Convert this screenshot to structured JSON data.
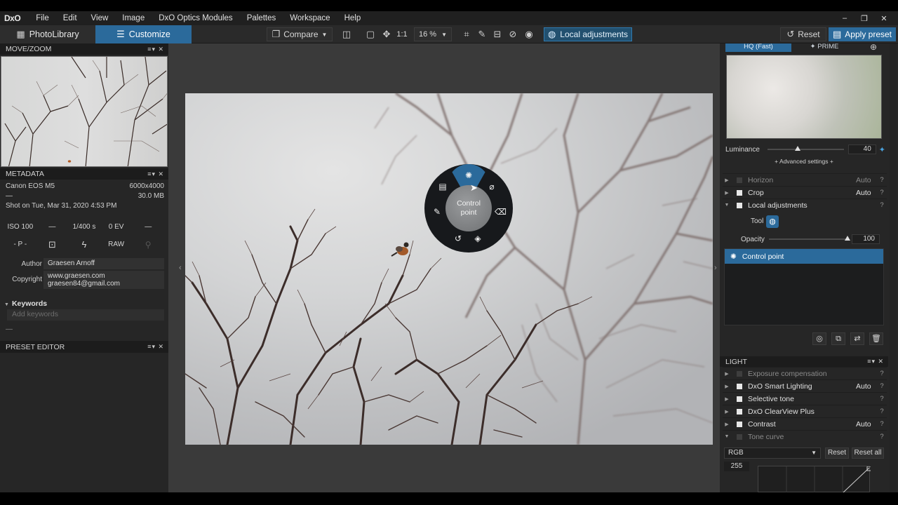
{
  "menubar": {
    "logo": "DxO",
    "items": [
      "File",
      "Edit",
      "View",
      "Image",
      "DxO Optics Modules",
      "Palettes",
      "Workspace",
      "Help"
    ],
    "window_controls": [
      "–",
      "❐",
      "✕"
    ]
  },
  "toolbar": {
    "photolibrary": "PhotoLibrary",
    "customize": "Customize",
    "compare": "Compare",
    "zoom_one": "1:1",
    "zoom_value": "16 %",
    "local_adjustments": "Local adjustments",
    "reset": "Reset",
    "apply_preset": "Apply preset"
  },
  "move_zoom": {
    "title": "MOVE/ZOOM"
  },
  "metadata": {
    "title": "METADATA",
    "camera": "Canon EOS M5",
    "resolution": "6000x4000",
    "dash": "—",
    "filesize": "30.0 MB",
    "shot_on": "Shot on Tue, Mar 31, 2020 4:53 PM",
    "grid_row1": [
      "ISO 100",
      "—",
      "1/400 s",
      "0 EV",
      "—"
    ],
    "grid_row2": [
      "- P -",
      "",
      "",
      "RAW",
      ""
    ],
    "author_label": "Author",
    "author_value": "Graesen Arnoff",
    "copyright_label": "Copyright",
    "copyright_line1": "www.graesen.com",
    "copyright_line2": "graesen84@gmail.com",
    "keywords_label": "Keywords",
    "keywords_placeholder": "Add keywords",
    "keywords_dash": "—"
  },
  "preset_editor": {
    "title": "PRESET EDITOR"
  },
  "wheel": {
    "center_line1": "Control",
    "center_line2": "point"
  },
  "right": {
    "tab_hq": "HQ (Fast)",
    "tab_prime": "✦ PRIME",
    "luminance_label": "Luminance",
    "luminance_value": "40",
    "luminance_fraction": 0.4,
    "advanced": "+ Advanced settings +",
    "rows_top": [
      {
        "name": "Horizon",
        "auto": "Auto",
        "q": "?",
        "dim": true
      },
      {
        "name": "Crop",
        "auto": "Auto",
        "q": "?",
        "dim": false
      },
      {
        "name": "Local adjustments",
        "auto": "",
        "q": "?",
        "dim": false
      }
    ],
    "tool_label": "Tool",
    "opacity_label": "Opacity",
    "opacity_value": "100",
    "opacity_fraction": 1.0,
    "control_point": "Control point",
    "light_title": "LIGHT",
    "light_rows": [
      {
        "name": "Exposure compensation",
        "auto": "",
        "q": "?",
        "dim": true
      },
      {
        "name": "DxO Smart Lighting",
        "auto": "Auto",
        "q": "?",
        "dim": false
      },
      {
        "name": "Selective tone",
        "auto": "",
        "q": "?",
        "dim": false
      },
      {
        "name": "DxO ClearView Plus",
        "auto": "",
        "q": "?",
        "dim": false
      },
      {
        "name": "Contrast",
        "auto": "Auto",
        "q": "?",
        "dim": false
      },
      {
        "name": "Tone curve",
        "auto": "",
        "q": "?",
        "dim": true
      }
    ],
    "rgb": "RGB",
    "reset": "Reset",
    "reset_all": "Reset all",
    "curve_value": "255"
  },
  "colors": {
    "accent": "#2b6a9b",
    "panel": "#262626",
    "canvas": "#3a3a3a"
  }
}
